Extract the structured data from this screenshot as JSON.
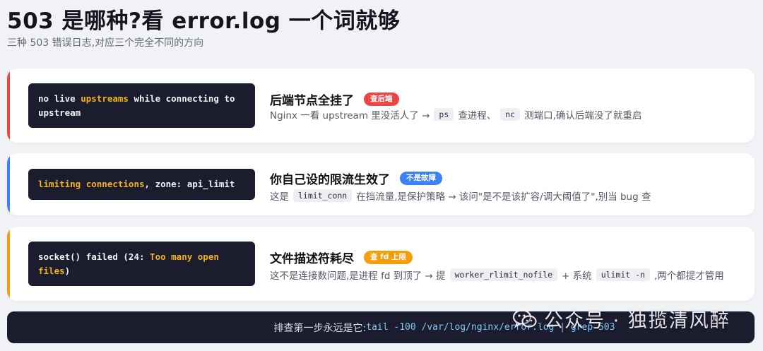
{
  "page": {
    "title": "503 是哪种?看 error.log 一个词就够",
    "subtitle": "三种 503 错误日志,对应三个完全不同的方向"
  },
  "cards": [
    {
      "accent": "#ef4444",
      "log_parts": [
        "no live ",
        "upstreams",
        " while connecting to upstream"
      ],
      "heading": "后端节点全挂了",
      "badge": "查后端",
      "badge_color": "#ef4444",
      "desc": [
        "Nginx 一看 upstream 里没活人了 → ",
        "ps",
        " 查进程、",
        "nc",
        " 测端口,确认后端没了就重启"
      ]
    },
    {
      "accent": "#3b82f6",
      "log_parts": [
        "limiting connections",
        ", zone: api_limit"
      ],
      "heading": "你自己设的限流生效了",
      "badge": "不是故障",
      "badge_color": "#3b82f6",
      "desc": [
        "这是 ",
        "limit_conn",
        " 在挡流量,是保护策略 → 该问\"是不是该扩容/调大阈值了\",别当 bug 查"
      ]
    },
    {
      "accent": "#f59e0b",
      "log_parts": [
        "socket() failed (24: ",
        "Too many open files",
        ")"
      ],
      "heading": "文件描述符耗尽",
      "badge": "查 fd 上限",
      "badge_color": "#f59e0b",
      "desc": [
        "这不是连接数问题,是进程 fd 到顶了 → 提 ",
        "worker_rlimit_nofile",
        " + 系统 ",
        "ulimit -n",
        " ,两个都提才管用"
      ]
    }
  ],
  "footer": {
    "label": "排查第一步永远是它:",
    "command": "tail -100 /var/log/nginx/error.log | grep 503"
  },
  "watermark": {
    "icon": "wechat-icon",
    "text": "公众号 · 独揽清风醉"
  }
}
